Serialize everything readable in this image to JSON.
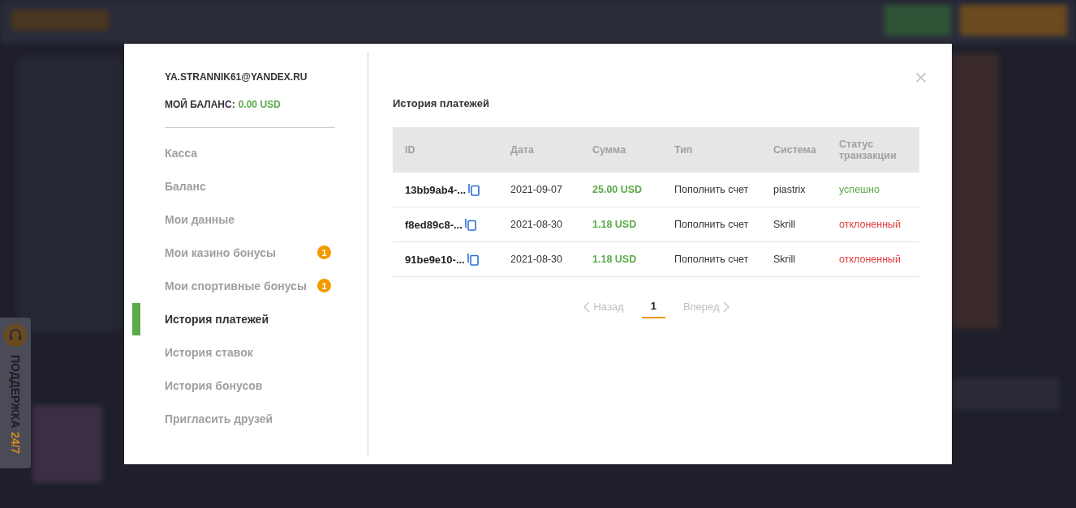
{
  "account": {
    "email": "YA.STRANNIK61@YANDEX.RU",
    "balance_label": "МОЙ БАЛАНС:",
    "balance_value": "0.00 USD"
  },
  "menu": [
    {
      "label": "Касса",
      "selected": false
    },
    {
      "label": "Баланс",
      "selected": false
    },
    {
      "label": "Мои данные",
      "selected": false
    },
    {
      "label": "Мои казино бонусы",
      "selected": false,
      "badge": "1"
    },
    {
      "label": "Мои спортивные бонусы",
      "selected": false,
      "badge": "1"
    },
    {
      "label": "История платежей",
      "selected": true
    },
    {
      "label": "История ставок",
      "selected": false
    },
    {
      "label": "История бонусов",
      "selected": false
    },
    {
      "label": "Пригласить друзей",
      "selected": false
    }
  ],
  "title": "История платежей",
  "table": {
    "columns": [
      "ID",
      "Дата",
      "Сумма",
      "Тип",
      "Система",
      "Статус транзакции"
    ],
    "rows": [
      {
        "id": "13bb9ab4-...",
        "date": "2021-09-07",
        "amount": "25.00 USD",
        "type": "Пополнить счет",
        "system": "piastrix",
        "status": "успешно",
        "color": "#5aaa4a"
      },
      {
        "id": "f8ed89c8-...",
        "date": "2021-08-30",
        "amount": "1.18 USD",
        "type": "Пополнить счет",
        "system": "Skrill",
        "status": "отклоненный",
        "color": "#e03c3c"
      },
      {
        "id": "91be9e10-...",
        "date": "2021-08-30",
        "amount": "1.18 USD",
        "type": "Пополнить счет",
        "system": "Skrill",
        "status": "отклоненный",
        "color": "#e03c3c"
      }
    ]
  },
  "pagination": {
    "prev": "Назад",
    "pages": [
      {
        "label": "1",
        "selected": true
      }
    ],
    "next": "Вперед"
  },
  "close": "×",
  "support": {
    "label": "ПОДДЕРЖКА",
    "hours": "24/7"
  }
}
